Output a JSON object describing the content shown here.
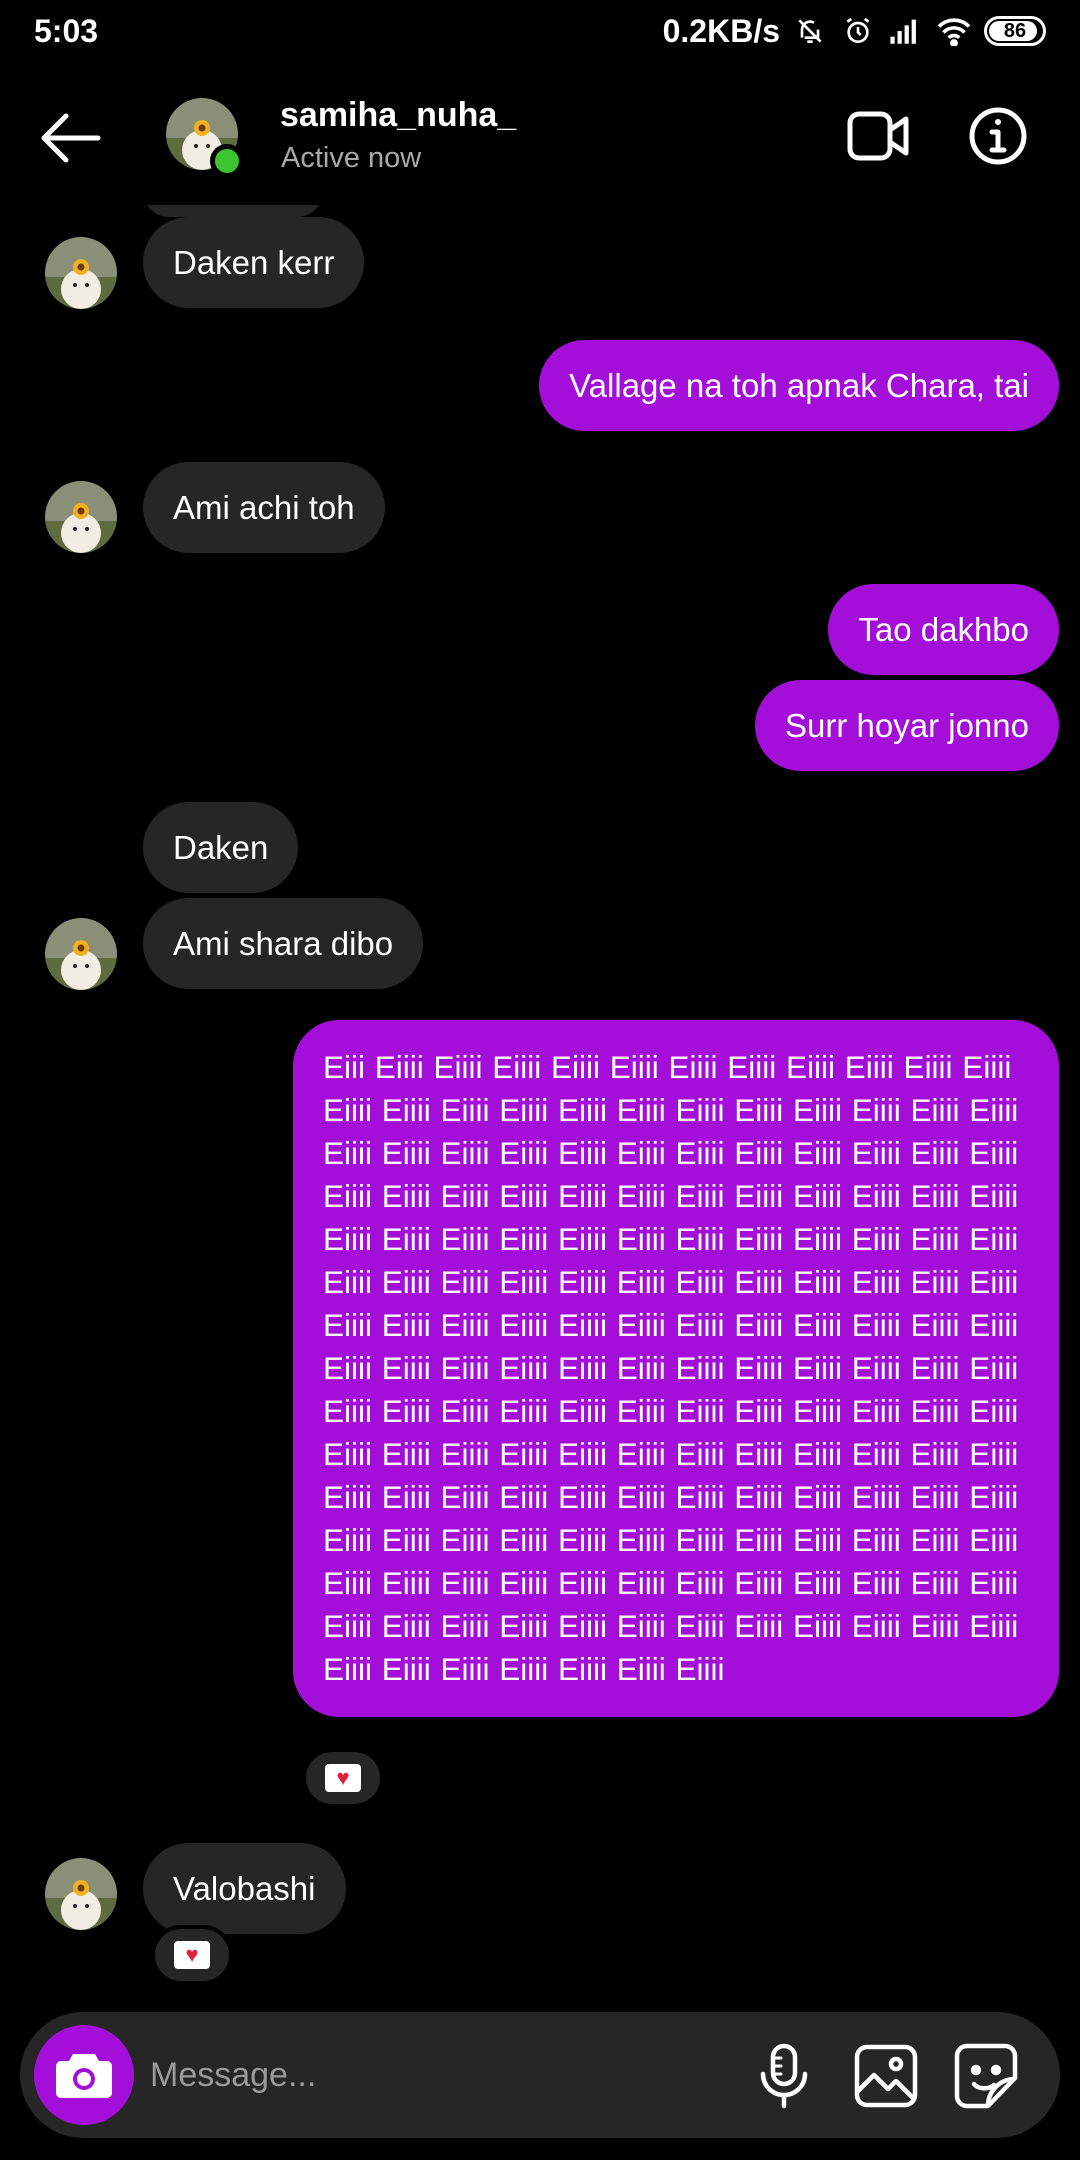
{
  "status_bar": {
    "time": "5:03",
    "network_speed": "0.2KB/s",
    "battery": "86",
    "icons": [
      "mute-bell-icon",
      "alarm-icon",
      "signal-icon",
      "wifi-icon",
      "battery-icon"
    ]
  },
  "header": {
    "username": "samiha_nuha_",
    "status": "Active now",
    "icons": [
      "back-arrow-icon",
      "video-call-icon",
      "info-icon"
    ]
  },
  "messages": [
    {
      "sender": "them",
      "text": "Daken kerr"
    },
    {
      "sender": "me",
      "text": "Vallage na toh apnak Chara, tai"
    },
    {
      "sender": "them",
      "text": "Ami achi toh"
    },
    {
      "sender": "me",
      "text": "Tao dakhbo"
    },
    {
      "sender": "me",
      "text": "Surr hoyar jonno"
    },
    {
      "sender": "them",
      "text": "Daken"
    },
    {
      "sender": "them",
      "text": "Ami shara dibo"
    },
    {
      "sender": "me",
      "text": "Eiii Eiiii Eiiii Eiiii Eiiii Eiiii Eiiii Eiiii Eiiii Eiiii Eiiii Eiiii Eiiii Eiiii Eiiii Eiiii Eiiii Eiiii Eiiii Eiiii Eiiii Eiiii Eiiii Eiiii Eiiii Eiiii Eiiii Eiiii Eiiii Eiiii Eiiii Eiiii Eiiii Eiiii Eiiii Eiiii Eiiii Eiiii Eiiii Eiiii Eiiii Eiiii Eiiii Eiiii Eiiii Eiiii Eiiii Eiiii Eiiii Eiiii Eiiii Eiiii Eiiii Eiiii Eiiii Eiiii Eiiii Eiiii Eiiii Eiiii Eiiii Eiiii Eiiii Eiiii Eiiii Eiiii Eiiii Eiiii Eiiii Eiiii Eiiii Eiiii Eiiii Eiiii Eiiii Eiiii Eiiii Eiiii Eiiii Eiiii Eiiii Eiiii Eiiii Eiiii Eiiii Eiiii Eiiii Eiiii Eiiii Eiiii Eiiii Eiiii Eiiii Eiiii Eiiii Eiiii Eiiii Eiiii Eiiii Eiiii Eiiii Eiiii Eiiii Eiiii Eiiii Eiiii Eiiii Eiiii Eiiii Eiiii Eiiii Eiiii Eiiii Eiiii Eiiii Eiiii Eiiii Eiiii Eiiii Eiiii Eiiii Eiiii Eiiii Eiiii Eiiii Eiiii Eiiii Eiiii Eiiii Eiiii Eiiii Eiiii Eiiii Eiiii Eiiii Eiiii Eiiii Eiiii Eiiii Eiiii Eiiii Eiiii Eiiii Eiiii Eiiii Eiiii Eiiii Eiiii Eiiii Eiiii Eiiii Eiiii Eiiii Eiiii Eiiii Eiiii Eiiii Eiiii Eiiii Eiiii Eiiii Eiiii Eiiii Eiiii Eiiii Eiiii Eiiii Eiiii Eiiii Eiiii Eiiii Eiiii Eiiii Eiiii Eiiii",
      "reaction": "heart-letter-icon"
    },
    {
      "sender": "them",
      "text": "Valobashi",
      "reaction": "heart-letter-icon"
    }
  ],
  "composer": {
    "placeholder": "Message...",
    "icons": [
      "camera-icon",
      "microphone-icon",
      "gallery-icon",
      "sticker-icon"
    ]
  },
  "colors": {
    "background": "#000000",
    "incoming_bubble": "#262626",
    "outgoing_bubble": "#a30fd8",
    "online": "#3ec430"
  }
}
